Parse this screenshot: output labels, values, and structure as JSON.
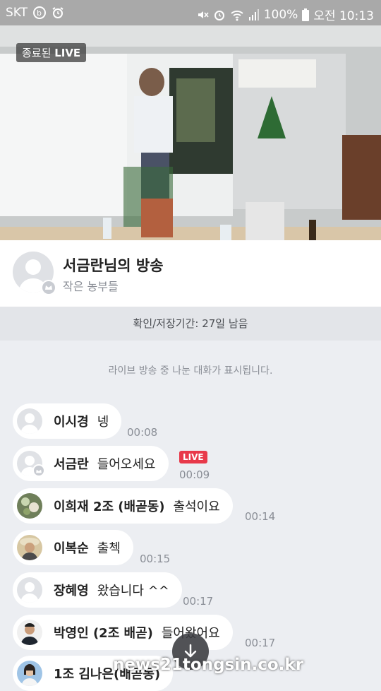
{
  "status_bar": {
    "carrier": "SKT",
    "battery": "100%",
    "time": "오전 10:13"
  },
  "video": {
    "badge_prefix": "종료된",
    "badge_live": "LIVE"
  },
  "broadcast": {
    "title": "서금란님의 방송",
    "channel": "작은 농부들"
  },
  "storage_notice": "확인/저장기간: 27일 남음",
  "chat_notice": "라이브 방송 중 나눈 대화가 표시됩니다.",
  "live_badge": "LIVE",
  "messages": [
    {
      "name": "이시경",
      "text": "넹",
      "time": "00:08"
    },
    {
      "name": "서금란",
      "text": "들어오세요",
      "time": "00:09"
    },
    {
      "name": "이희재 2조 (배곧동)",
      "text": "출석이요",
      "time": "00:14"
    },
    {
      "name": "이복순",
      "text": "출첵",
      "time": "00:15"
    },
    {
      "name": "장혜영",
      "text": "왔습니다 ^^",
      "time": "00:17"
    },
    {
      "name": "박영인 (2조 배곧)",
      "text": "들어왔어요",
      "time": "00:17"
    },
    {
      "name": "1조 김나은(배곧동)",
      "text": "",
      "time": ""
    }
  ],
  "watermark": "news21tongsin.co.kr",
  "icons": {
    "scroll_down": "arrow-down-icon"
  }
}
